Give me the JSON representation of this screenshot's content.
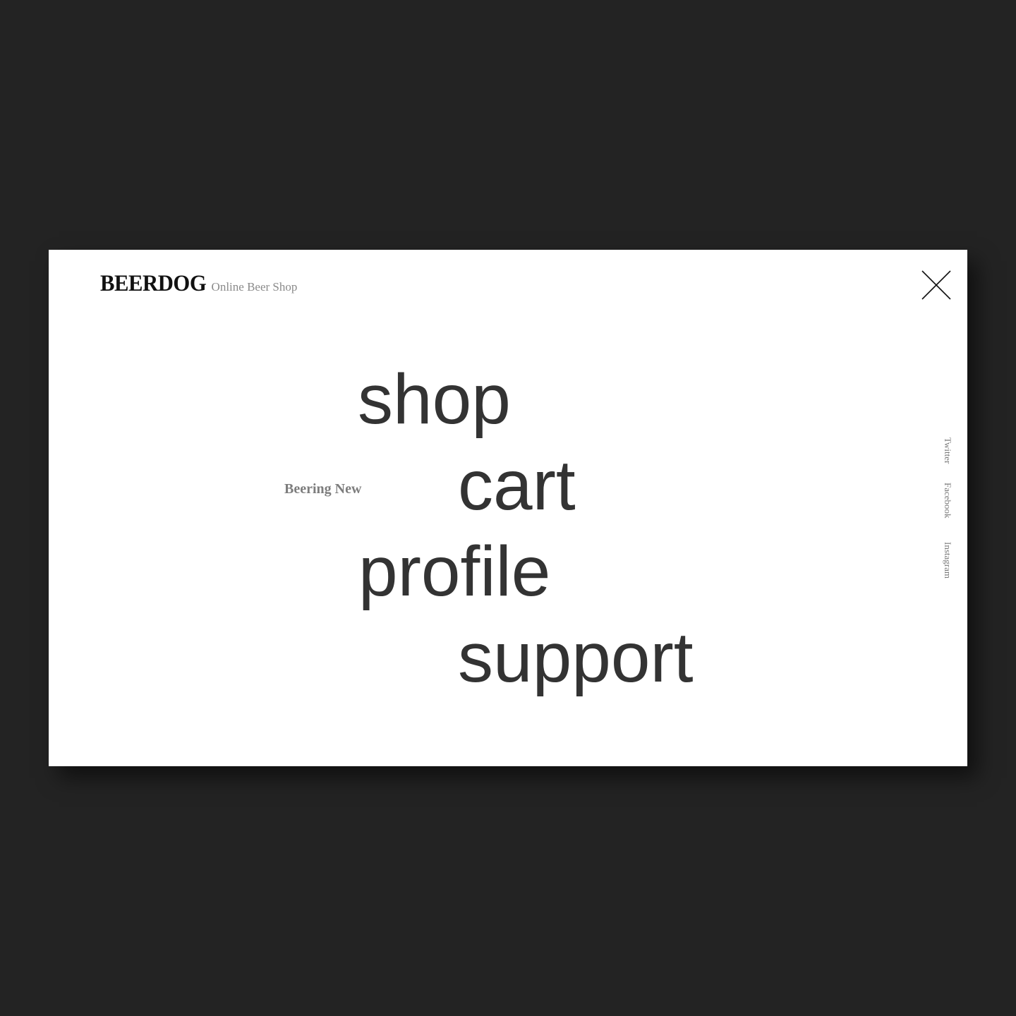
{
  "brand": {
    "logo": "BEERDOG",
    "tagline": "Online Beer Shop"
  },
  "menu": {
    "close_icon": "close-icon",
    "items": [
      {
        "label": "shop"
      },
      {
        "label": "cart"
      },
      {
        "label": "profile"
      },
      {
        "label": "support"
      }
    ],
    "side_label": "Beering New"
  },
  "social": {
    "links": [
      {
        "label": "Twitter"
      },
      {
        "label": "Facebook"
      },
      {
        "label": "Instagram"
      }
    ]
  },
  "colors": {
    "background": "#232323",
    "panel": "#ffffff",
    "text_primary": "#333333",
    "text_muted": "#8a8a8a"
  }
}
